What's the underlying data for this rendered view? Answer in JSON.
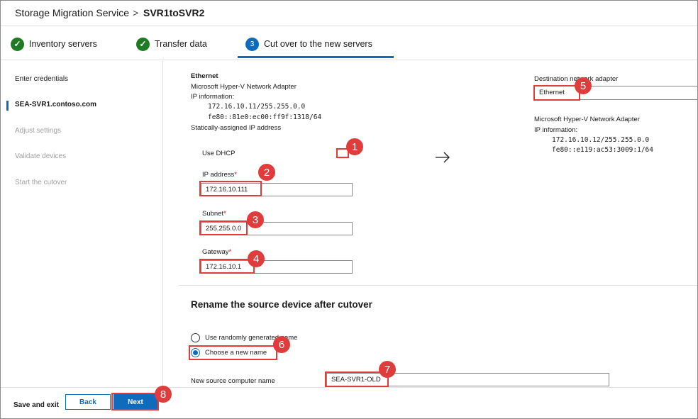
{
  "header": {
    "service": "Storage Migration Service",
    "separator": ">",
    "job": "SVR1toSVR2"
  },
  "steps": [
    {
      "label": "Inventory servers",
      "state": "done"
    },
    {
      "label": "Transfer data",
      "state": "done"
    },
    {
      "label": "Cut over to the new servers",
      "state": "current",
      "number": "3"
    }
  ],
  "icons": {
    "check": "check-icon",
    "arrow": "arrow-right-icon"
  },
  "leftnav": {
    "items": [
      {
        "label": "Enter credentials",
        "state": "normal"
      },
      {
        "label": "SEA-SVR1.contoso.com",
        "state": "active"
      },
      {
        "label": "Adjust settings",
        "state": "disabled"
      },
      {
        "label": "Validate devices",
        "state": "disabled"
      },
      {
        "label": "Start the cutover",
        "state": "disabled"
      }
    ]
  },
  "source": {
    "adapter_name": "Ethernet",
    "adapter_desc": "Microsoft Hyper-V Network Adapter",
    "ip_info_label": "IP information:",
    "ipv4": "172.16.10.11/255.255.0.0",
    "ipv6": "fe80::81e0:ec00:ff9f:1318/64",
    "static_note": "Statically-assigned IP address",
    "dhcp_label": "Use DHCP",
    "ip_label": "IP address",
    "ip_value": "172.16.10.111",
    "subnet_label": "Subnet",
    "subnet_value": "255.255.0.0",
    "gateway_label": "Gateway",
    "gateway_value": "172.16.10.1",
    "required_mark": "*"
  },
  "destination": {
    "label": "Destination network adapter",
    "selected": "Ethernet",
    "adapter_desc": "Microsoft Hyper-V Network Adapter",
    "ip_info_label": "IP information:",
    "ipv4": "172.16.10.12/255.255.0.0",
    "ipv6": "fe80::e119:ac53:3009:1/64"
  },
  "rename": {
    "title": "Rename the source device after cutover",
    "option_random": "Use randomly generated name",
    "option_choose": "Choose a new name",
    "new_name_label": "New source computer name",
    "new_name_value": "SEA-SVR1-OLD"
  },
  "footer": {
    "save_exit": "Save and exit",
    "back": "Back",
    "next": "Next"
  },
  "callouts": [
    "1",
    "2",
    "3",
    "4",
    "5",
    "6",
    "7",
    "8"
  ],
  "colors": {
    "accent": "#0f6cbd",
    "success": "#1f7a24",
    "callout": "#e03c3c"
  }
}
